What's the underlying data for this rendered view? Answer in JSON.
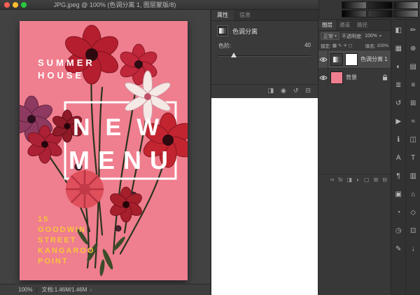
{
  "window": {
    "title": "JPG.jpeg @ 100% (色调分离 1, 图层蒙版/8)",
    "traffic_lights": {
      "close": "#ff5f57",
      "minimize": "#febc2e",
      "zoom": "#28c840"
    }
  },
  "options_bar": {
    "gradient_swatches": [
      {
        "name": "gradient-swatch",
        "from": "#0b0b0b",
        "to": "#6e6e6e"
      },
      {
        "name": "gradient-swatch",
        "from": "#2a2a2a",
        "to": "#050505"
      },
      {
        "name": "gradient-swatch",
        "from": "#161616",
        "to": "#8a8a8a"
      },
      {
        "name": "gradient-swatch",
        "from": "#000000",
        "to": "#555555"
      },
      {
        "name": "gradient-swatch",
        "from": "#3a3a3a",
        "to": "#101010"
      },
      {
        "name": "gradient-swatch",
        "from": "#1f1f1f",
        "to": "#777777"
      }
    ]
  },
  "document_area": {
    "status": {
      "zoom": "100%",
      "info": "文档:1.46M/1.46M",
      "caret": "›"
    },
    "poster": {
      "title_line1": "SUMMER",
      "title_line2": "HOUSE",
      "headline_line1": "NEW",
      "headline_line2": "MENU",
      "address_lines": [
        "15",
        "GOODWIN",
        "STREET",
        "KANGAROO",
        "POINT"
      ],
      "colors": {
        "background": "#ef7e8e",
        "headline": "#ffffff",
        "address": "#f8c53d",
        "flower_red": "#b51e2e"
      }
    }
  },
  "properties_panel": {
    "tabs": [
      {
        "label": "属性"
      },
      {
        "label": "信息"
      }
    ],
    "adjustment_title": "色调分离",
    "levels": {
      "label": "色阶:",
      "value": "40",
      "percent": 14
    },
    "footer_icons": [
      {
        "name": "clip-to-layer-icon",
        "glyph": "◨"
      },
      {
        "name": "visibility-icon",
        "glyph": "◉"
      },
      {
        "name": "reset-icon",
        "glyph": "↺"
      },
      {
        "name": "delete-adjustment-icon",
        "glyph": "⊟"
      }
    ]
  },
  "layers_panel": {
    "tabs": [
      {
        "label": "图层"
      },
      {
        "label": "通道"
      },
      {
        "label": "路径"
      }
    ],
    "blend_mode": "正常",
    "caret": "▾",
    "opacity_label": "不透明度:",
    "opacity_value": "100%",
    "lock_label": "锁定:",
    "lock_icons": [
      {
        "name": "lock-transparency-icon",
        "glyph": "▦"
      },
      {
        "name": "lock-pixels-icon",
        "glyph": "✎"
      },
      {
        "name": "lock-position-icon",
        "glyph": "✛"
      },
      {
        "name": "lock-all-icon",
        "glyph": "◻"
      }
    ],
    "fill_label": "填充:",
    "fill_value": "100%",
    "layers": [
      {
        "name": "色调分离 1",
        "type": "adjustment"
      },
      {
        "name": "背景",
        "locked": true
      }
    ],
    "footer_icons": [
      {
        "name": "link-layers-icon",
        "glyph": "∞"
      },
      {
        "name": "layer-styles-icon",
        "glyph": "fx"
      },
      {
        "name": "layer-mask-icon",
        "glyph": "◨"
      },
      {
        "name": "adjustment-layer-icon",
        "glyph": "◐"
      },
      {
        "name": "layer-group-icon",
        "glyph": "▢"
      },
      {
        "name": "new-layer-icon",
        "glyph": "⊞"
      },
      {
        "name": "delete-layer-icon",
        "glyph": "⊟"
      }
    ]
  },
  "right_rail": {
    "col1": [
      {
        "name": "color-panel-icon",
        "glyph": "◧"
      },
      {
        "name": "swatches-panel-icon",
        "glyph": "▦"
      },
      {
        "name": "adjustments-panel-icon",
        "glyph": "◐"
      },
      {
        "name": "styles-panel-icon",
        "glyph": "≣"
      },
      {
        "name": "history-panel-icon",
        "glyph": "↺"
      },
      {
        "name": "actions-panel-icon",
        "glyph": "▶"
      },
      {
        "name": "info-panel-icon",
        "glyph": "ℹ"
      },
      {
        "name": "character-panel-icon",
        "glyph": "A"
      },
      {
        "name": "paragraph-panel-icon",
        "glyph": "¶"
      },
      {
        "name": "channels-panel-icon",
        "glyph": "▣"
      },
      {
        "name": "paths-panel-icon",
        "glyph": "◔"
      },
      {
        "name": "timeline-panel-icon",
        "glyph": "◷"
      },
      {
        "name": "notes-panel-icon",
        "glyph": "✎"
      }
    ],
    "col2": [
      {
        "name": "brush-settings-panel-icon",
        "glyph": "✏"
      },
      {
        "name": "clone-source-panel-icon",
        "glyph": "⊕"
      },
      {
        "name": "layer-comps-panel-icon",
        "glyph": "▤"
      },
      {
        "name": "measurement-log-panel-icon",
        "glyph": "≡"
      },
      {
        "name": "navigator-panel-icon",
        "glyph": "⊞"
      },
      {
        "name": "histogram-panel-icon",
        "glyph": "≈"
      },
      {
        "name": "tool-presets-panel-icon",
        "glyph": "◫"
      },
      {
        "name": "glyphs-panel-icon",
        "glyph": "T"
      },
      {
        "name": "libraries-panel-icon",
        "glyph": "▥"
      },
      {
        "name": "device-preview-panel-icon",
        "glyph": "⌂"
      },
      {
        "name": "threed-panel-icon",
        "glyph": "◇"
      },
      {
        "name": "properties-panel-icon",
        "glyph": "⊡"
      },
      {
        "name": "export-panel-icon",
        "glyph": "↓"
      }
    ]
  }
}
